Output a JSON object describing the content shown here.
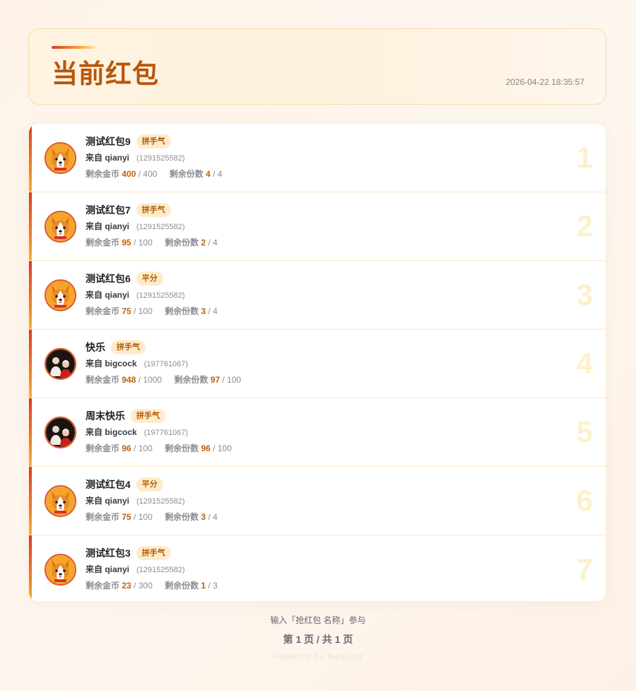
{
  "header": {
    "title": "当前红包",
    "timestamp": "2026-04-22 18:35:57"
  },
  "labels": {
    "from_prefix": "来自",
    "coins_label": "剩余金币",
    "shares_label": "剩余份数"
  },
  "rows": [
    {
      "index": "1",
      "name": "测试红包9",
      "type": "拼手气",
      "from": "来自 qianyi",
      "user_id": "(1291525582)",
      "coins_left": "400",
      "coins_total": "/ 400",
      "shares_left": "4",
      "shares_total": "/ 4",
      "avatar": "corgi-avatar"
    },
    {
      "index": "2",
      "name": "测试红包7",
      "type": "拼手气",
      "from": "来自 qianyi",
      "user_id": "(1291525582)",
      "coins_left": "95",
      "coins_total": "/ 100",
      "shares_left": "2",
      "shares_total": "/ 4",
      "avatar": "corgi-avatar"
    },
    {
      "index": "3",
      "name": "测试红包6",
      "type": "平分",
      "from": "来自 qianyi",
      "user_id": "(1291525582)",
      "coins_left": "75",
      "coins_total": "/ 100",
      "shares_left": "3",
      "shares_total": "/ 4",
      "avatar": "corgi-avatar"
    },
    {
      "index": "4",
      "name": "快乐",
      "type": "拼手气",
      "from": "来自 bigcock",
      "user_id": "(197761067)",
      "coins_left": "948",
      "coins_total": "/ 1000",
      "shares_left": "97",
      "shares_total": "/ 100",
      "avatar": "people-avatar"
    },
    {
      "index": "5",
      "name": "周末快乐",
      "type": "拼手气",
      "from": "来自 bigcock",
      "user_id": "(197761067)",
      "coins_left": "96",
      "coins_total": "/ 100",
      "shares_left": "96",
      "shares_total": "/ 100",
      "avatar": "people-avatar"
    },
    {
      "index": "6",
      "name": "测试红包4",
      "type": "平分",
      "from": "来自 qianyi",
      "user_id": "(1291525582)",
      "coins_left": "75",
      "coins_total": "/ 100",
      "shares_left": "3",
      "shares_total": "/ 4",
      "avatar": "corgi-avatar"
    },
    {
      "index": "7",
      "name": "测试红包3",
      "type": "拼手气",
      "from": "来自 qianyi",
      "user_id": "(1291525582)",
      "coins_left": "23",
      "coins_total": "/ 300",
      "shares_left": "1",
      "shares_total": "/ 3",
      "avatar": "corgi-avatar"
    }
  ],
  "footer": {
    "hint": "输入「抢红包 名称」参与",
    "page": "第 1 页 / 共 1 页",
    "powered": "Powered by NextBot"
  },
  "colors": {
    "title": "#b8560a",
    "accent_red": "#d9382f",
    "accent_orange": "#ee8a25",
    "badge_bg": "#fdeccc",
    "number": "#c2600a"
  }
}
